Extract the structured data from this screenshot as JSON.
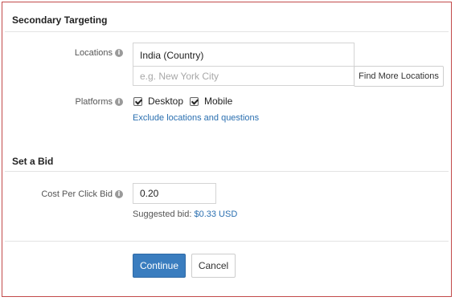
{
  "secondary_targeting": {
    "title": "Secondary Targeting",
    "locations_label": "Locations",
    "selected_location": "India (Country)",
    "location_placeholder": "e.g. New York City",
    "find_more_button": "Find More Locations",
    "platforms_label": "Platforms",
    "platforms": [
      {
        "label": "Desktop",
        "checked": true
      },
      {
        "label": "Mobile",
        "checked": true
      }
    ],
    "exclude_link": "Exclude locations and questions"
  },
  "bid": {
    "title": "Set a Bid",
    "cpc_label": "Cost Per Click Bid",
    "cpc_value": "0.20",
    "suggested_label": "Suggested bid:",
    "suggested_value": "$0.33 USD"
  },
  "actions": {
    "continue_label": "Continue",
    "cancel_label": "Cancel"
  },
  "info_icon_glyph": "i",
  "colors": {
    "accent": "#3a7dbf",
    "link": "#2a6fb0",
    "frame_border": "#c24a4a"
  }
}
